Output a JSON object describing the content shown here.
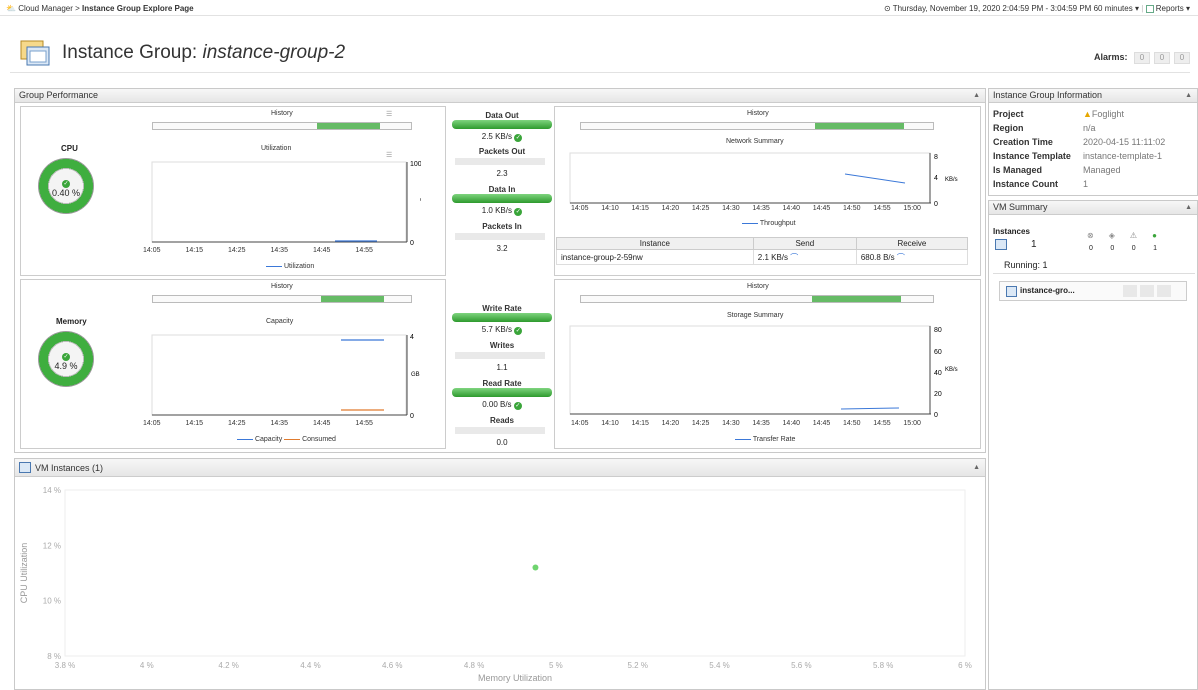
{
  "topbar": {
    "logo_icon": "cloud-manager-icon",
    "crumb_root": "Cloud Manager",
    "crumb_sep": ">",
    "crumb_current": "Instance Group Explore Page",
    "time_range": "⊙ Thursday, November 19, 2020 2:04:59 PM - 3:04:59 PM 60 minutes",
    "reports": "Reports"
  },
  "header": {
    "title_prefix": "Instance Group:",
    "title_name": "instance-group-2",
    "alarms_label": "Alarms:",
    "alarm_counts": [
      "0",
      "0",
      "0"
    ]
  },
  "group_perf": {
    "title": "Group Performance",
    "cpu": {
      "label": "CPU",
      "value": "0.40 %",
      "history": "History",
      "chart_title": "Utilization",
      "ymax": "100",
      "ymin": "0",
      "unit": "%",
      "ticks": [
        "14:05",
        "14:15",
        "14:25",
        "14:35",
        "14:45",
        "14:55"
      ],
      "legend": "Utilization"
    },
    "memory": {
      "label": "Memory",
      "value": "4.9 %",
      "history": "History",
      "chart_title": "Capacity",
      "ymax": "4",
      "ymin": "0",
      "unit": "GB",
      "ticks": [
        "14:05",
        "14:15",
        "14:25",
        "14:35",
        "14:45",
        "14:55"
      ],
      "legend1": "Capacity",
      "legend2": "Consumed"
    },
    "net_metrics": {
      "data_out": "Data Out",
      "data_out_val": "2.5 KB/s",
      "packets_out": "Packets Out",
      "packets_out_val": "2.3",
      "data_in": "Data In",
      "data_in_val": "1.0 KB/s",
      "packets_in": "Packets In",
      "packets_in_val": "3.2"
    },
    "disk_metrics": {
      "write_rate": "Write Rate",
      "write_rate_val": "5.7 KB/s",
      "writes": "Writes",
      "writes_val": "1.1",
      "read_rate": "Read Rate",
      "read_rate_val": "0.00 B/s",
      "reads": "Reads",
      "reads_val": "0.0"
    },
    "network": {
      "history": "History",
      "chart_title": "Network Summary",
      "y": [
        "8",
        "4",
        "0"
      ],
      "unit": "KB/s",
      "ticks": [
        "14:05",
        "14:10",
        "14:15",
        "14:20",
        "14:25",
        "14:30",
        "14:35",
        "14:40",
        "14:45",
        "14:50",
        "14:55",
        "15:00"
      ],
      "legend": "Throughput",
      "table": {
        "headers": [
          "Instance",
          "Send",
          "Receive"
        ],
        "rows": [
          [
            "instance-group-2-59nw",
            "2.1 KB/s",
            "680.8 B/s"
          ]
        ]
      }
    },
    "storage": {
      "history": "History",
      "chart_title": "Storage Summary",
      "y": [
        "80",
        "60",
        "40",
        "20",
        "0"
      ],
      "unit": "KB/s",
      "ticks": [
        "14:05",
        "14:10",
        "14:15",
        "14:20",
        "14:25",
        "14:30",
        "14:35",
        "14:40",
        "14:45",
        "14:50",
        "14:55",
        "15:00"
      ],
      "legend": "Transfer Rate"
    }
  },
  "vm_instances": {
    "title": "VM Instances (1)"
  },
  "chart_data": {
    "type": "scatter",
    "xlabel": "Memory Utilization",
    "ylabel": "CPU Utilization",
    "x_ticks": [
      "3.8 %",
      "4 %",
      "4.2 %",
      "4.4 %",
      "4.6 %",
      "4.8 %",
      "5 %",
      "5.2 %",
      "5.4 %",
      "5.6 %",
      "5.8 %",
      "6 %"
    ],
    "y_ticks": [
      "14 %",
      "12 %",
      "10 %",
      "8 %"
    ],
    "xlim": [
      3.8,
      6
    ],
    "ylim": [
      8,
      14
    ],
    "points": [
      {
        "x": 4.95,
        "y": 11.2
      }
    ],
    "point_color": "#6fd46f"
  },
  "info": {
    "title": "Instance Group Information",
    "rows": [
      {
        "k": "Project",
        "v": "Foglight"
      },
      {
        "k": "Region",
        "v": "n/a"
      },
      {
        "k": "Creation Time",
        "v": "2020-04-15 11:11:02"
      },
      {
        "k": "Instance Template",
        "v": "instance-template-1"
      },
      {
        "k": "Is Managed",
        "v": "Managed"
      },
      {
        "k": "Instance Count",
        "v": "1"
      }
    ]
  },
  "vm_summary": {
    "title": "VM Summary",
    "instances_label": "Instances",
    "instances_count": "1",
    "status_counts": [
      "0",
      "0",
      "0",
      "1"
    ],
    "running": "Running: 1",
    "item": "instance-gro..."
  }
}
